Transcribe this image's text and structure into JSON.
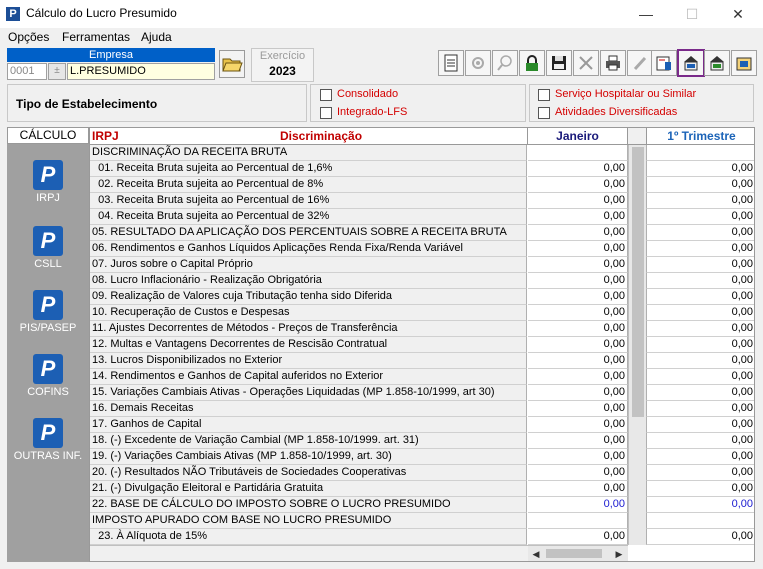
{
  "window": {
    "title": "Cálculo do Lucro Presumido",
    "app_icon_letter": "P",
    "minimize": "—",
    "maximize": "☐",
    "close": "✕"
  },
  "menu": [
    "Opções",
    "Ferramentas",
    "Ajuda"
  ],
  "empresa": {
    "label": "Empresa",
    "code": "0001",
    "name": "L.PRESUMIDO"
  },
  "exercicio": {
    "label": "Exercício",
    "value": "2023"
  },
  "toolbar": {
    "icons": [
      "new-document-icon",
      "settings-icon",
      "search-icon",
      "lock-icon",
      "save-icon",
      "delete-icon",
      "print-icon",
      "edit-icon",
      "report-icon",
      "calculate-icon",
      "calculate-all-icon",
      "export-icon"
    ],
    "highlight_color": "#7a2a8a"
  },
  "estabelecimento": {
    "label": "Tipo de Estabelecimento",
    "options_left": [
      "Consolidado",
      "Integrado-LFS"
    ],
    "options_right": [
      "Serviço Hospitalar ou Similar",
      "Atividades Diversificadas"
    ]
  },
  "calculo": {
    "header": "CÁLCULO",
    "items": [
      "IRPJ",
      "CSLL",
      "PIS/PASEP",
      "COFINS",
      "OUTRAS INF."
    ]
  },
  "grid": {
    "tax_label": "IRPJ",
    "col_desc": "Discriminação",
    "col_v1": "Janeiro",
    "col_v2": "1º Trimestre",
    "rows": [
      {
        "desc": "DISCRIMINAÇÃO DA RECEITA BRUTA",
        "v1": "",
        "v2": "",
        "type": "section"
      },
      {
        "desc": "  01. Receita Bruta sujeita ao Percentual de 1,6%",
        "v1": "0,00",
        "v2": "0,00",
        "type": "normal"
      },
      {
        "desc": "  02. Receita Bruta sujeita ao Percentual de 8%",
        "v1": "0,00",
        "v2": "0,00",
        "type": "normal"
      },
      {
        "desc": "  03. Receita Bruta sujeita ao Percentual de 16%",
        "v1": "0,00",
        "v2": "0,00",
        "type": "normal"
      },
      {
        "desc": "  04. Receita Bruta sujeita ao Percentual de 32%",
        "v1": "0,00",
        "v2": "0,00",
        "type": "normal"
      },
      {
        "desc": "05. RESULTADO DA APLICAÇÃO DOS PERCENTUAIS SOBRE A RECEITA BRUTA",
        "v1": "0,00",
        "v2": "0,00",
        "type": "normal"
      },
      {
        "desc": "06. Rendimentos e Ganhos Líquidos Aplicações Renda Fixa/Renda Variável",
        "v1": "0,00",
        "v2": "0,00",
        "type": "normal"
      },
      {
        "desc": "07. Juros sobre o Capital Próprio",
        "v1": "0,00",
        "v2": "0,00",
        "type": "normal"
      },
      {
        "desc": "08. Lucro Inflacionário - Realização Obrigatória",
        "v1": "0,00",
        "v2": "0,00",
        "type": "normal"
      },
      {
        "desc": "09. Realização de Valores cuja Tributação tenha sido Diferida",
        "v1": "0,00",
        "v2": "0,00",
        "type": "normal"
      },
      {
        "desc": "10. Recuperação de Custos e Despesas",
        "v1": "0,00",
        "v2": "0,00",
        "type": "normal"
      },
      {
        "desc": "11. Ajustes Decorrentes de Métodos - Preços de Transferência",
        "v1": "0,00",
        "v2": "0,00",
        "type": "normal"
      },
      {
        "desc": "12. Multas e Vantagens Decorrentes de Rescisão Contratual",
        "v1": "0,00",
        "v2": "0,00",
        "type": "normal"
      },
      {
        "desc": "13. Lucros Disponibilizados no Exterior",
        "v1": "0,00",
        "v2": "0,00",
        "type": "normal"
      },
      {
        "desc": "14. Rendimentos e Ganhos de Capital auferidos no Exterior",
        "v1": "0,00",
        "v2": "0,00",
        "type": "normal"
      },
      {
        "desc": "15. Variações Cambiais Ativas - Operações Liquidadas (MP 1.858-10/1999, art 30)",
        "v1": "0,00",
        "v2": "0,00",
        "type": "normal"
      },
      {
        "desc": "16. Demais Receitas",
        "v1": "0,00",
        "v2": "0,00",
        "type": "normal"
      },
      {
        "desc": "17. Ganhos de Capital",
        "v1": "0,00",
        "v2": "0,00",
        "type": "normal"
      },
      {
        "desc": "18. (-) Excedente de Variação Cambial (MP 1.858-10/1999. art. 31)",
        "v1": "0,00",
        "v2": "0,00",
        "type": "normal"
      },
      {
        "desc": "19. (-) Variações Cambiais Ativas (MP 1.858-10/1999, art. 30)",
        "v1": "0,00",
        "v2": "0,00",
        "type": "normal"
      },
      {
        "desc": "20. (-) Resultados NÃO Tributáveis de Sociedades Cooperativas",
        "v1": "0,00",
        "v2": "0,00",
        "type": "normal"
      },
      {
        "desc": "21. (-) Divulgação Eleitoral e Partidária Gratuita",
        "v1": "0,00",
        "v2": "0,00",
        "type": "normal"
      },
      {
        "desc": "22. BASE DE CÁLCULO DO IMPOSTO SOBRE O LUCRO PRESUMIDO",
        "v1": "0,00",
        "v2": "0,00",
        "type": "blue"
      },
      {
        "desc": "IMPOSTO APURADO COM BASE NO LUCRO PRESUMIDO",
        "v1": "",
        "v2": "",
        "type": "section"
      },
      {
        "desc": "  23. À Alíquota de 15%",
        "v1": "0,00",
        "v2": "0,00",
        "type": "normal"
      }
    ]
  }
}
